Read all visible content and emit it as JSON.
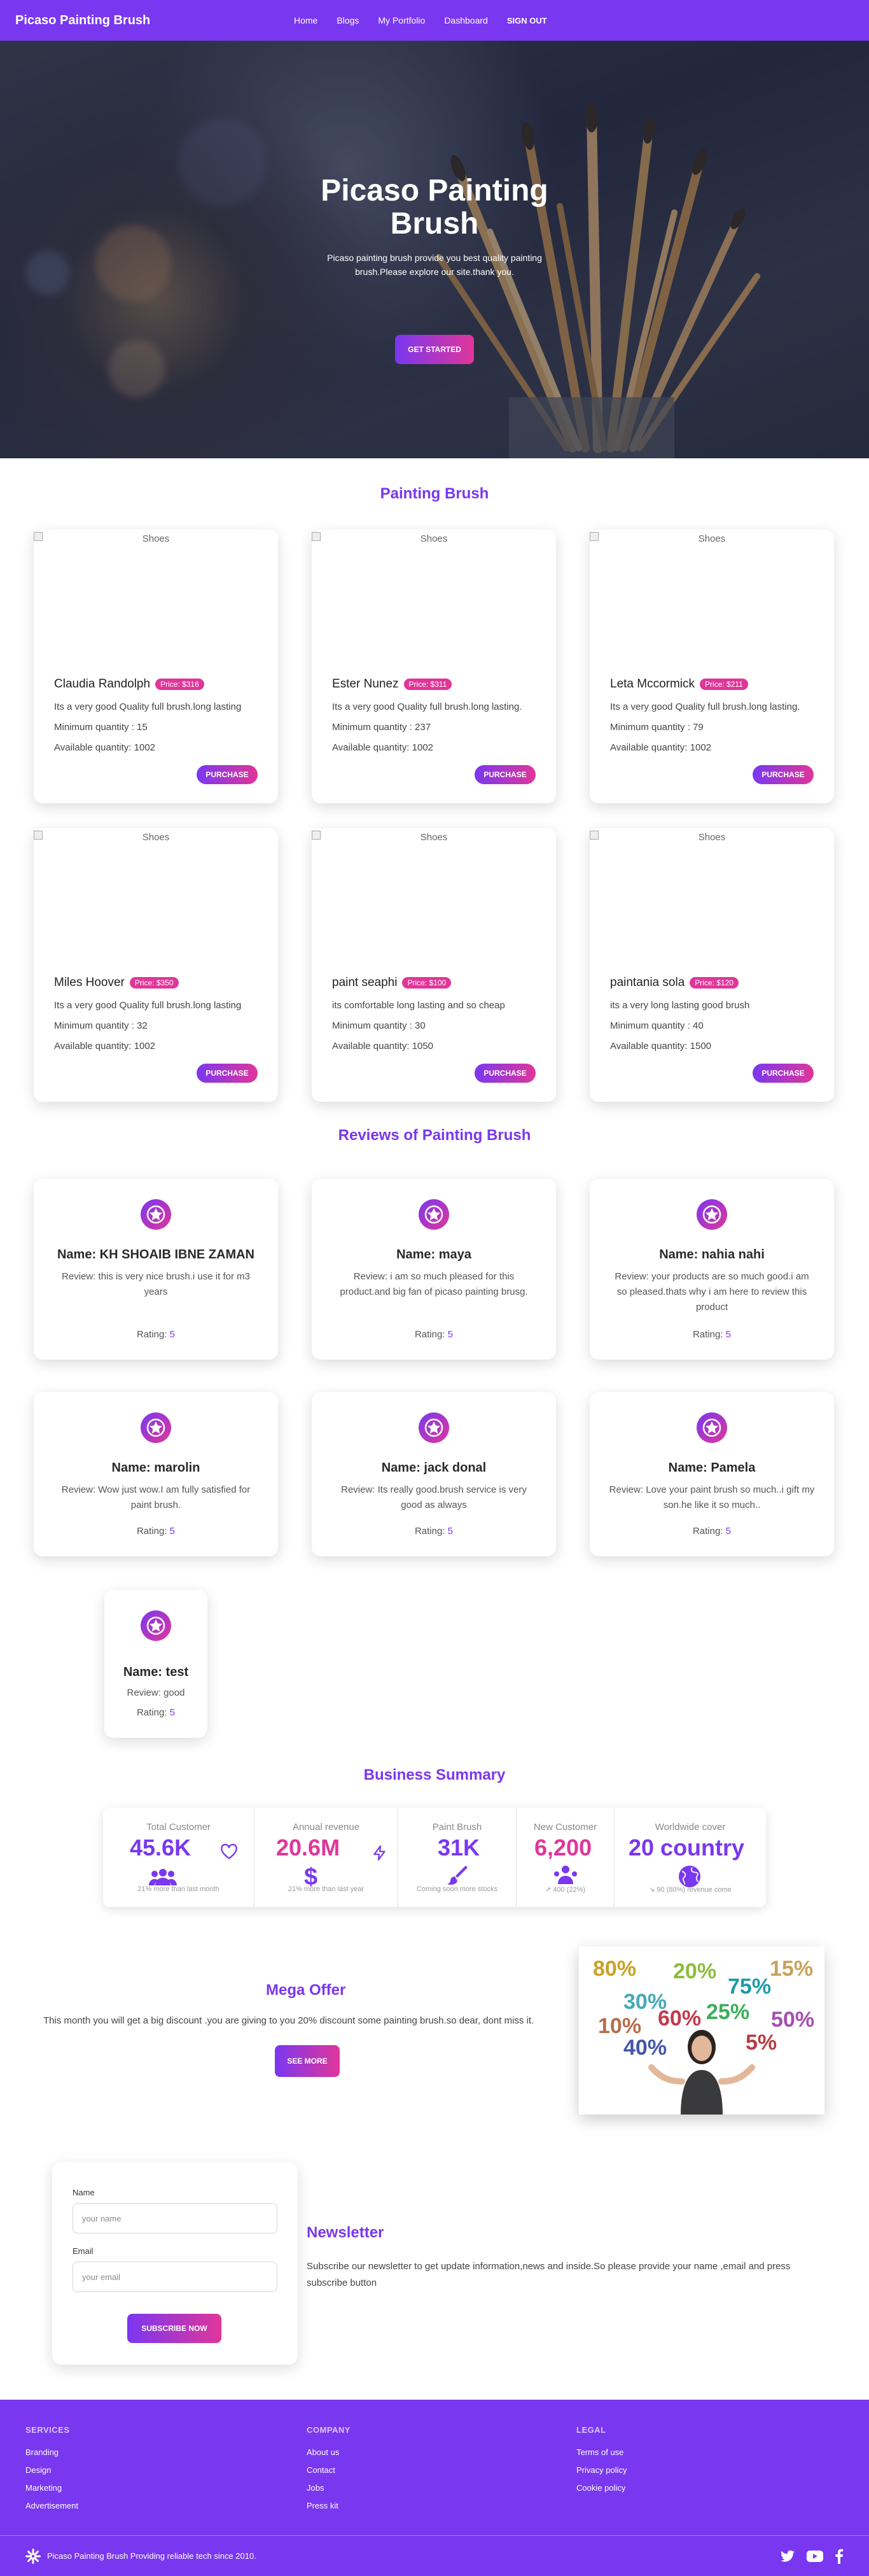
{
  "nav": {
    "brand": "Picaso Painting Brush",
    "links": [
      "Home",
      "Blogs",
      "My Portfolio",
      "Dashboard"
    ],
    "signout": "SIGN OUT"
  },
  "hero": {
    "title": "Picaso Painting Brush",
    "subtitle": "Picaso painting brush provide you best quality painting brush.Please explore our site.thank you.",
    "button": "GET STARTED"
  },
  "products": {
    "title": "Painting Brush",
    "img_alt": "Shoes",
    "purchase_label": "PURCHASE",
    "items": [
      {
        "name": "Claudia Randolph",
        "price": "Price: $316",
        "desc": "Its a very good Quality full brush.long lasting",
        "min": "Minimum quantity : 15",
        "avail": "Available quantity: 1002"
      },
      {
        "name": "Ester Nunez",
        "price": "Price: $311",
        "desc": "Its a very good Quality full brush.long lasting.",
        "min": "Minimum quantity : 237",
        "avail": "Available quantity: 1002"
      },
      {
        "name": "Leta Mccormick",
        "price": "Price: $211",
        "desc": "Its a very good Quality full brush.long lasting.",
        "min": "Minimum quantity : 79",
        "avail": "Available quantity: 1002"
      },
      {
        "name": "Miles Hoover",
        "price": "Price: $350",
        "desc": "Its a very good Quality full brush.long lasting",
        "min": "Minimum quantity : 32",
        "avail": "Available quantity: 1002"
      },
      {
        "name": "paint seaphi",
        "price": "Price: $100",
        "desc": "its comfortable long lasting and so cheap",
        "min": "Minimum quantity : 30",
        "avail": "Available quantity: 1050"
      },
      {
        "name": "paintania sola",
        "price": "Price: $120",
        "desc": "its a very long lasting good brush",
        "min": "Minimum quantity : 40",
        "avail": "Available quantity: 1500"
      }
    ]
  },
  "reviews": {
    "title": "Reviews of Painting Brush",
    "rating_label": "Rating:",
    "items": [
      {
        "name": "Name: KH SHOAIB IBNE ZAMAN",
        "review": "Review: this is very nice brush.i use it for m3 years",
        "rating": "5"
      },
      {
        "name": "Name: maya",
        "review": "Review: i am so much pleased for this product.and big fan of picaso painting brusg.",
        "rating": "5"
      },
      {
        "name": "Name: nahia nahi",
        "review": "Review: your products are so much good.i am so pleased.thats why i am here to review this product",
        "rating": "5"
      },
      {
        "name": "Name: marolin",
        "review": "Review: Wow just wow.I am fully satisfied for paint brush.",
        "rating": "5"
      },
      {
        "name": "Name: jack donal",
        "review": "Review: Its really good.brush service is very good as always",
        "rating": "5"
      },
      {
        "name": "Name: Pamela",
        "review": "Review: Love your paint brush so much..i gift my son.he like it so much..",
        "rating": "5"
      },
      {
        "name": "Name: test",
        "review": "Review: good",
        "rating": "5"
      }
    ]
  },
  "summary": {
    "title": "Business Summary",
    "stats": [
      {
        "label": "Total Customer",
        "value": "45.6K",
        "sub": "21% more than last month",
        "icon": "users-icon"
      },
      {
        "label": "Annual revenue",
        "value": "20.6M",
        "sub": "21% more than last year",
        "icon": "dollar-icon"
      },
      {
        "label": "Paint Brush",
        "value": "31K",
        "sub": "Coming soon more stocks",
        "icon": "brush-icon"
      },
      {
        "label": "New Customer",
        "value": "6,200",
        "sub": "↗ 400 (22%)",
        "icon": "user-group-icon"
      },
      {
        "label": "Worldwide cover",
        "value": "20 country",
        "sub": "↘ 90 (80%) revenue come",
        "icon": "globe-icon"
      }
    ]
  },
  "offer": {
    "title": "Mega Offer",
    "text": "This month you will get a big discount .you are giving to you 20% discount some painting brush.so dear, dont miss it.",
    "button": "SEE MORE",
    "percents": [
      "80%",
      "20%",
      "75%",
      "15%",
      "30%",
      "60%",
      "25%",
      "10%",
      "50%",
      "40%",
      "5%"
    ]
  },
  "newsletter": {
    "name_label": "Name",
    "name_placeholder": "your name",
    "email_label": "Email",
    "email_placeholder": "your email",
    "button": "SUBSCRIBE NOW",
    "title": "Newsletter",
    "text": "Subscribe our newsletter to get update information,news and inside.So please provide your name ,email and press subscribe button"
  },
  "footer": {
    "services": {
      "title": "SERVICES",
      "links": [
        "Branding",
        "Design",
        "Marketing",
        "Advertisement"
      ]
    },
    "company": {
      "title": "COMPANY",
      "links": [
        "About us",
        "Contact",
        "Jobs",
        "Press kit"
      ]
    },
    "legal": {
      "title": "LEGAL",
      "links": [
        "Terms of use",
        "Privacy policy",
        "Cookie policy"
      ]
    },
    "copyright": "Picaso Painting Brush Providing reliable tech since 2010."
  },
  "colors": {
    "accent": "#7a37f0",
    "accent2": "#e0369a"
  }
}
